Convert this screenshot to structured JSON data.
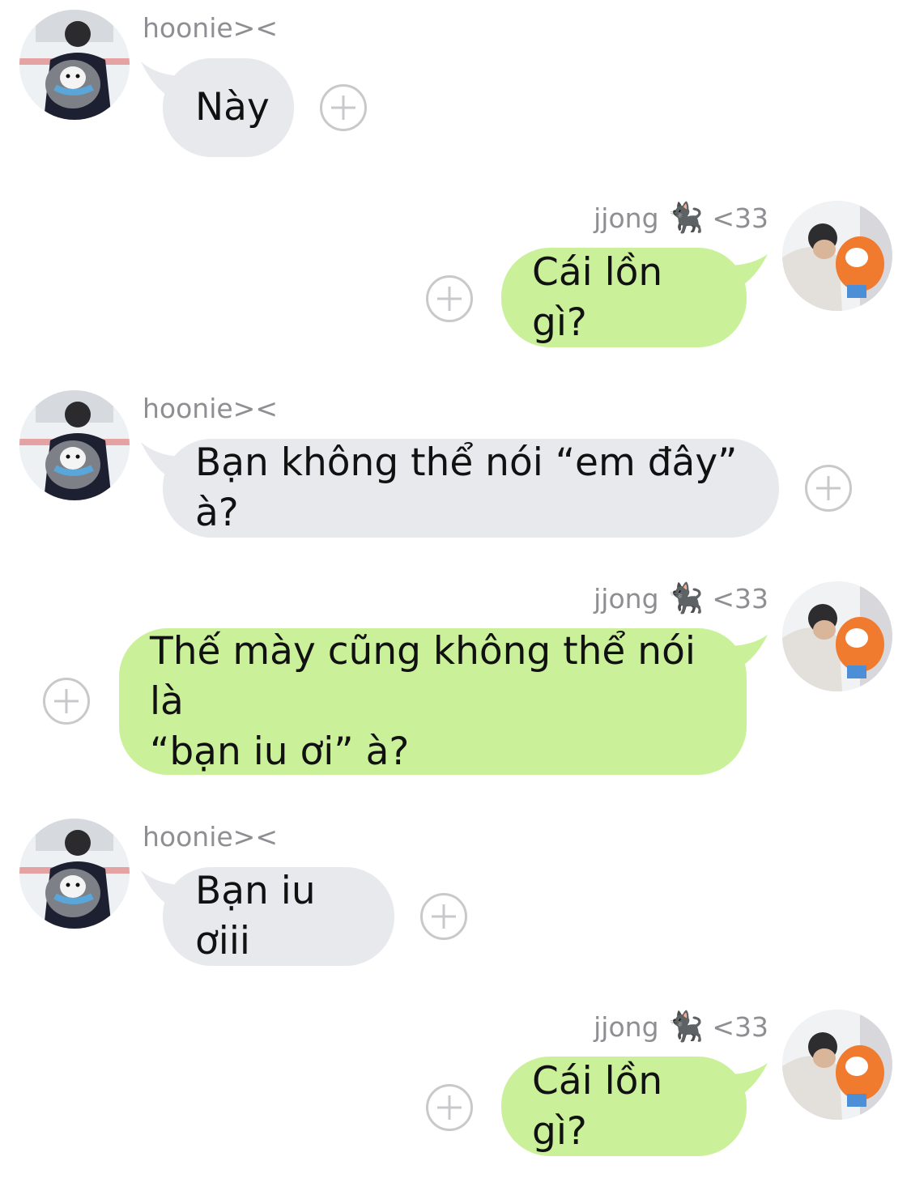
{
  "users": {
    "left": {
      "name": "hoonie><"
    },
    "right": {
      "name": "jjong",
      "emoji": "🐈‍⬛",
      "suffix": "<33"
    }
  },
  "messages": [
    {
      "from": "left",
      "text": "Này"
    },
    {
      "from": "right",
      "text": "Cái lồn gì?"
    },
    {
      "from": "left",
      "text": "Bạn không thể nói “em đây” à?"
    },
    {
      "from": "right",
      "text": "Thế mày cũng không thể nói là\n“bạn iu ơi” à?"
    },
    {
      "from": "left",
      "text": "Bạn iu ơiii"
    },
    {
      "from": "right",
      "text": "Cái lồn gì?"
    }
  ],
  "colors": {
    "left_bubble": "#e7e9ec",
    "right_bubble": "#caf099",
    "meta_text": "#8e8e93",
    "plus_button": "#c9c9cc"
  },
  "icons": {
    "plus": "plus-circle-icon",
    "cat": "black-cat-icon"
  }
}
